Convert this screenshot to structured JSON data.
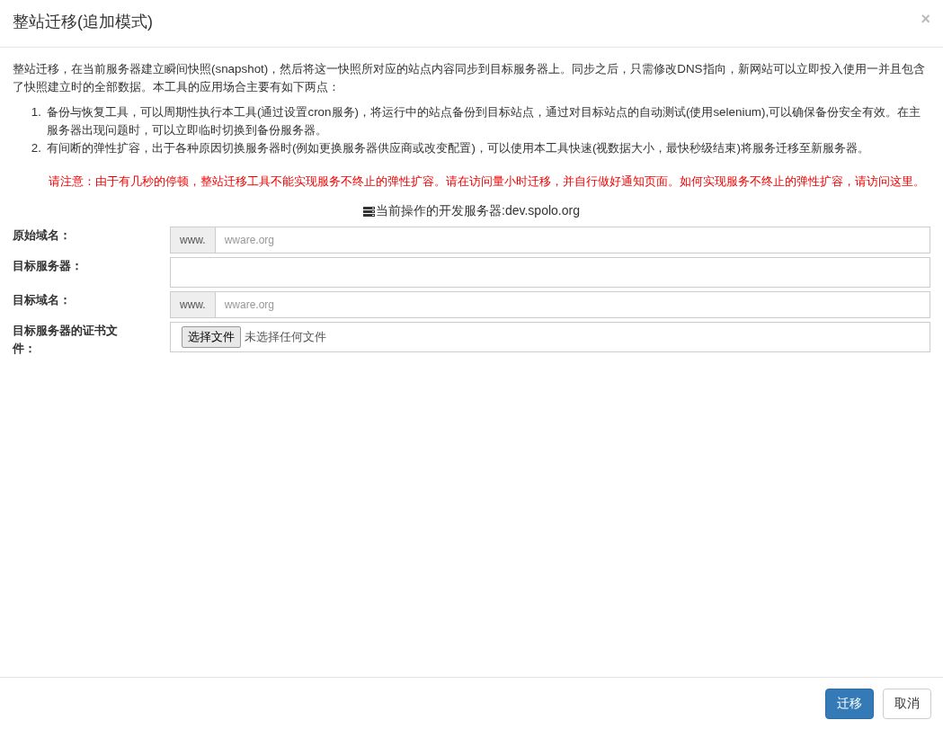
{
  "dialog": {
    "title": "整站迁移(追加模式)",
    "close": "×"
  },
  "intro": "整站迁移，在当前服务器建立瞬间快照(snapshot)，然后将这一快照所对应的站点内容同步到目标服务器上。同步之后，只需修改DNS指向，新网站可以立即投入使用一并且包含了快照建立时的全部数据。本工具的应用场合主要有如下两点：",
  "points": [
    {
      "number": "1.",
      "text": "备份与恢复工具，可以周期性执行本工具(通过设置cron服务)，将运行中的站点备份到目标站点，通过对目标站点的自动测试(使用selenium),可以确保备份安全有效。在主服务器出现问题时，可以立即临时切换到备份服务器。"
    },
    {
      "number": "2.",
      "text": "有间断的弹性扩容，出于各种原因切换服务器时(例如更换服务器供应商或改变配置)，可以使用本工具快速(视数据大小，最快秒级结束)将服务迁移至新服务器。"
    }
  ],
  "warning": "请注意：由于有几秒的停顿，整站迁移工具不能实现服务不终止的弹性扩容。请在访问量小时迁移，并自行做好通知页面。如何实现服务不终止的弹性扩容，请访问这里。",
  "server": "当前操作的开发服务器:dev.spolo.org",
  "fields": [
    {
      "kind": "addon",
      "label": "原始域名：",
      "addon": "www.",
      "placeholder": "wware.org"
    },
    {
      "kind": "text",
      "label": "目标服务器："
    },
    {
      "kind": "addon",
      "label": "目标域名：",
      "addon": "www.",
      "placeholder": "wware.org"
    },
    {
      "kind": "file",
      "label": "目标服务器的证书文件：",
      "button": "选择文件",
      "status": "未选择任何文件"
    }
  ],
  "buttons": [
    {
      "label": "迁移",
      "kind": "primary"
    },
    {
      "label": "取消",
      "kind": "default"
    }
  ]
}
